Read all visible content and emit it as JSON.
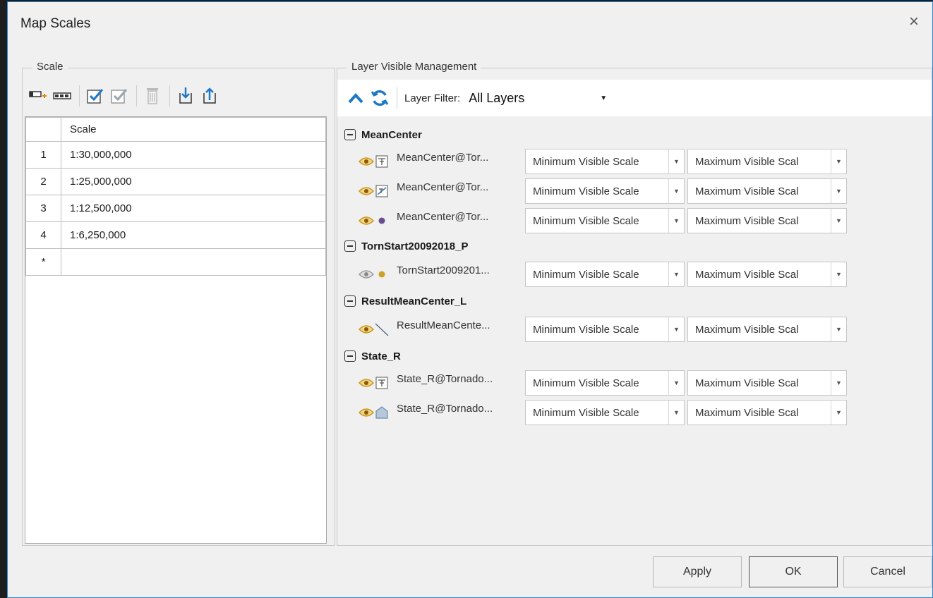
{
  "window": {
    "title": "Map Scales",
    "close_glyph": "×"
  },
  "scale_panel": {
    "legend": "Scale",
    "toolbar": [
      "add-scale-icon",
      "add-multiple-icon",
      "select-all-icon",
      "select-invert-icon",
      "delete-icon",
      "import-icon",
      "export-icon"
    ],
    "table": {
      "header": "Scale",
      "rows": [
        {
          "num": "1",
          "scale": "1:30,000,000"
        },
        {
          "num": "2",
          "scale": "1:25,000,000"
        },
        {
          "num": "3",
          "scale": "1:12,500,000"
        },
        {
          "num": "4",
          "scale": "1:6,250,000"
        },
        {
          "num": "*",
          "scale": ""
        }
      ]
    }
  },
  "layer_panel": {
    "legend": "Layer Visible Management",
    "filter_label": "Layer Filter:",
    "filter_value": "All Layers",
    "min_placeholder": "Minimum Visible Scale",
    "max_placeholder": "Maximum Visible Scal",
    "groups": [
      {
        "name": "MeanCenter",
        "layers": [
          {
            "name": "MeanCenter@Tor...",
            "type": "label-icon",
            "visible": true
          },
          {
            "name": "MeanCenter@Tor...",
            "type": "label-line-icon",
            "visible": true
          },
          {
            "name": "MeanCenter@Tor...",
            "type": "point-icon",
            "visible": true
          }
        ]
      },
      {
        "name": "TornStart20092018_P",
        "layers": [
          {
            "name": "TornStart2009201...",
            "type": "point-icon",
            "visible": false
          }
        ]
      },
      {
        "name": "ResultMeanCenter_L",
        "layers": [
          {
            "name": "ResultMeanCente...",
            "type": "line-icon",
            "visible": true
          }
        ]
      },
      {
        "name": "State_R",
        "layers": [
          {
            "name": "State_R@Tornado...",
            "type": "label-icon",
            "visible": true
          },
          {
            "name": "State_R@Tornado...",
            "type": "region-icon",
            "visible": true
          }
        ]
      }
    ]
  },
  "buttons": {
    "apply": "Apply",
    "ok": "OK",
    "cancel": "Cancel"
  },
  "colors": {
    "accent": "#1e78c8",
    "eye": "#d4a017",
    "point_purple": "#6a4c8c",
    "point_gold": "#c9a227"
  }
}
